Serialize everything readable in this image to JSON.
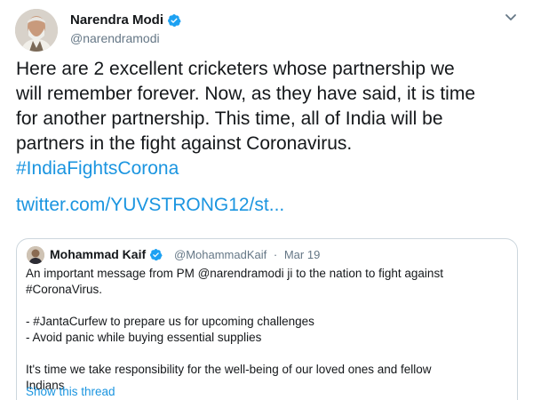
{
  "tweet": {
    "author_name": "Narendra Modi",
    "author_handle": "@narendramodi",
    "text_lines": [
      "Here are 2 excellent cricketers whose partnership we",
      "will remember forever. Now, as they have said, it is time",
      "for another partnership. This time, all of India will be",
      "partners in the fight against Coronavirus."
    ],
    "hashtag": "#IndiaFightsCorona",
    "link": "twitter.com/YUVSTRONG12/st..."
  },
  "quoted": {
    "author_name": "Mohammad Kaif",
    "author_handle": "@MohammadKaif",
    "separator": "·",
    "date": "Mar 19",
    "lines": [
      "An important message from PM @narendramodi ji to the nation to fight against",
      "#CoronaVirus.",
      "",
      "- #JantaCurfew to prepare us for upcoming challenges",
      "- Avoid panic while buying essential supplies",
      "",
      "It's time we take responsibility for the well-being of our loved ones and fellow",
      "Indians"
    ],
    "show_thread": "Show this thread"
  },
  "icons": {
    "verified": "verified-badge-icon",
    "caret": "chevron-down-icon"
  },
  "colors": {
    "link": "#1b95e0",
    "verified": "#1da1f2",
    "secondary_text": "#657786",
    "border": "#ccd6dd"
  }
}
